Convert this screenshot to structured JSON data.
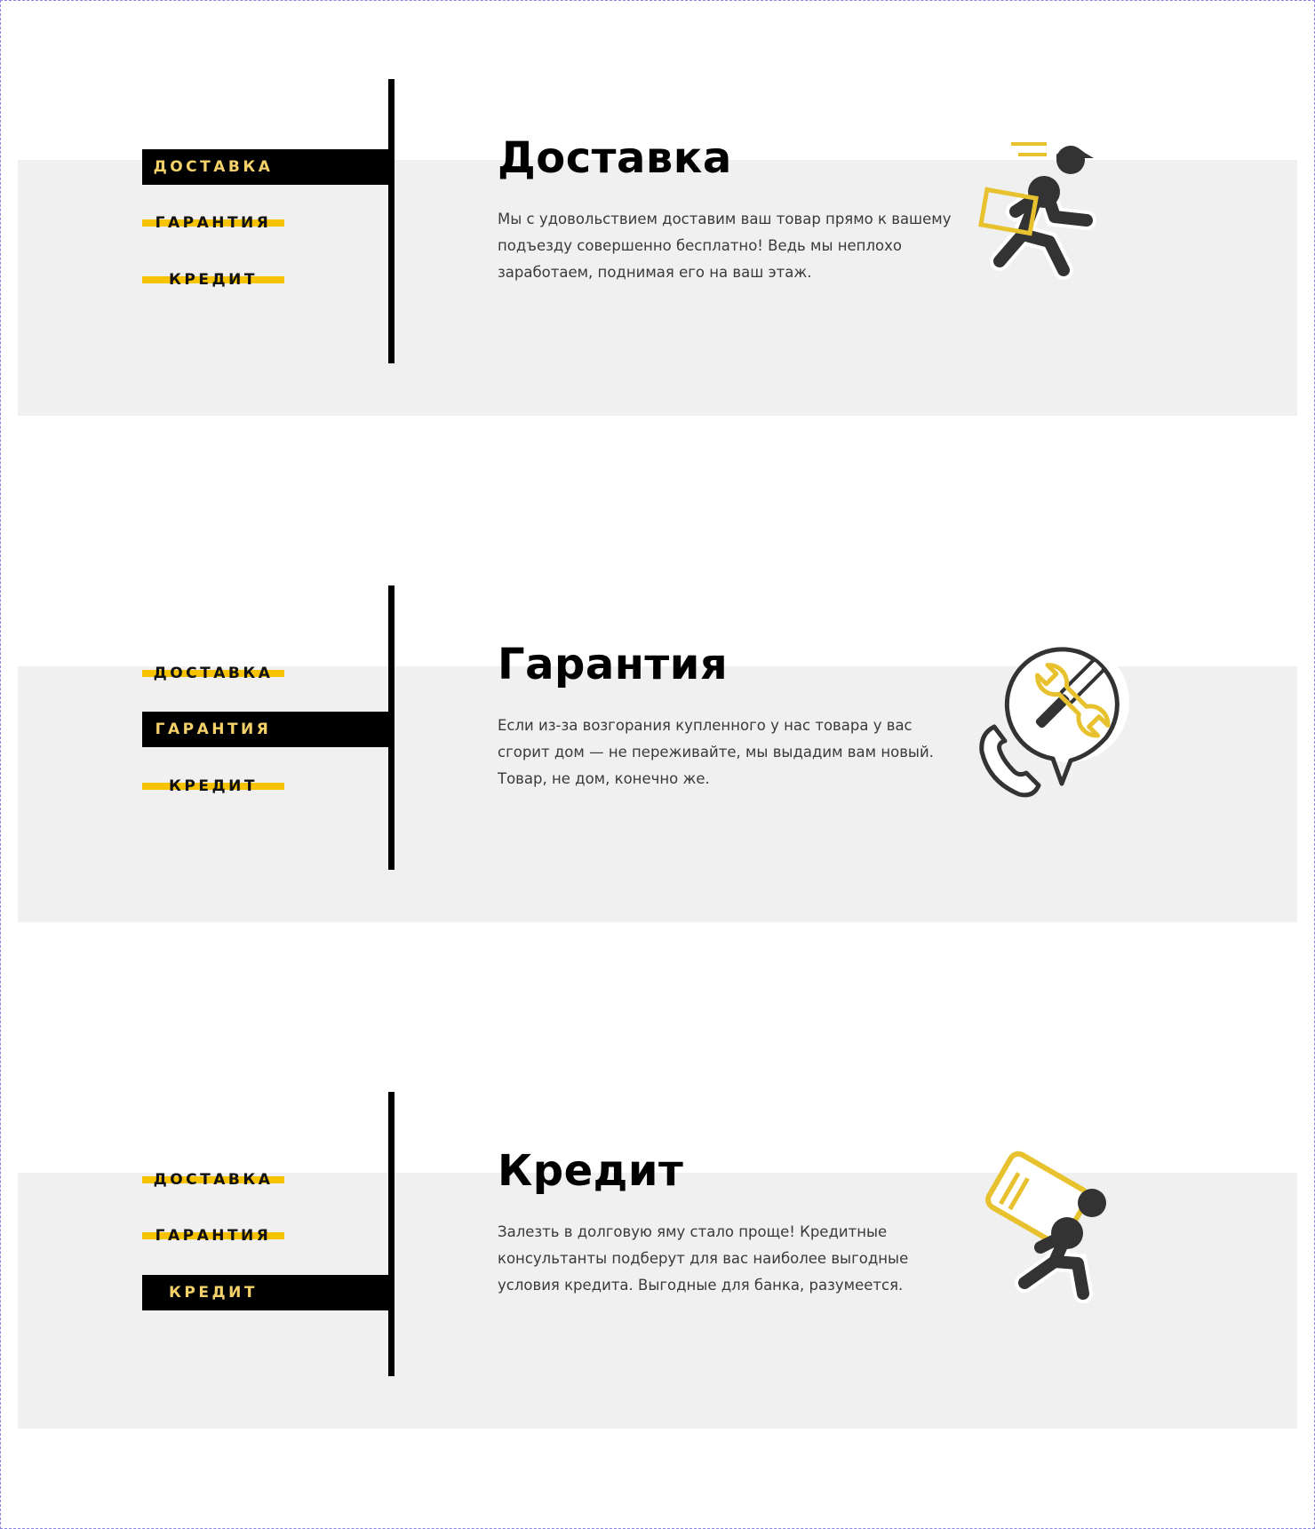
{
  "nav_labels": [
    "ДОСТАВКА",
    "ГАРАНТИЯ",
    "КРЕДИТ"
  ],
  "sections": [
    {
      "title": "Доставка",
      "description": "Мы с удовольствием доставим ваш товар прямо к вашему подъезду совершенно бесплатно! Ведь мы неплохо заработаем, поднимая его на ваш этаж.",
      "active_tab": 0,
      "icon": "delivery-runner-icon"
    },
    {
      "title": "Гарантия",
      "description": "Если из-за возгорания купленного у нас товара у вас сгорит дом — не переживайте, мы выдадим вам новый. Товар, не дом, конечно же.",
      "active_tab": 1,
      "icon": "support-tools-icon"
    },
    {
      "title": "Кредит",
      "description": "Залезть в долговую яму стало проще! Кредитные консультанты подберут для вас наиболее выгодные условия кредита. Выгодные для банка, разумеется.",
      "active_tab": 2,
      "icon": "credit-card-carrier-icon"
    }
  ],
  "colors": {
    "accent": "#f7c300",
    "active_text": "#f5d16a",
    "band": "#f0f0f0",
    "icon_dark": "#333333",
    "icon_yellow": "#e8c22e"
  }
}
